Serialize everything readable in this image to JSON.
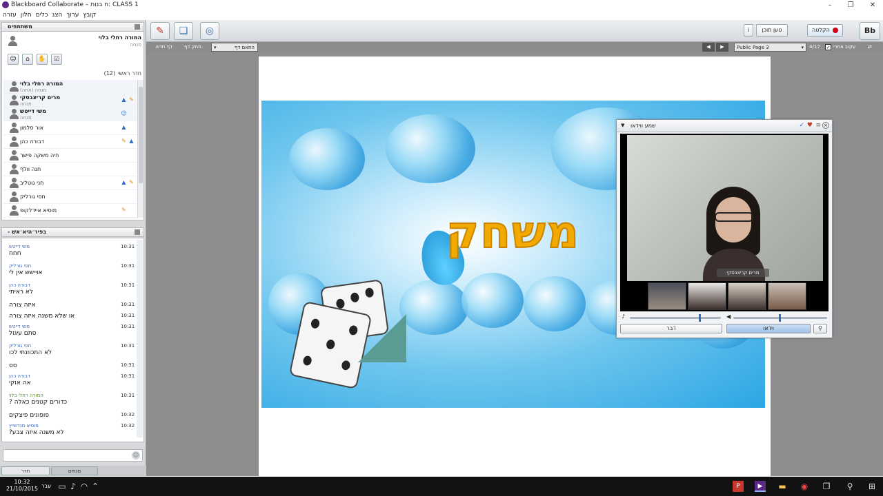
{
  "window": {
    "title": "Blackboard Collaborate – ח בנות: CLASS 1",
    "minimize": "–",
    "maximize": "❐",
    "close": "✕"
  },
  "menu": [
    "קובץ",
    "ערוך",
    "הצג",
    "כלים",
    "חלון",
    "עזרה"
  ],
  "participants_panel": {
    "header": "משתתפים",
    "self": {
      "name": "המורה רחלי בלוי",
      "role": "מנחה"
    },
    "room_label": "חדר ראשי",
    "count": "(12)",
    "list": [
      {
        "name": "המורה רחלי בלוי",
        "role": "מנחה (אתה)",
        "bold": true
      },
      {
        "name": "מרים קריצבסקי",
        "role": "מנחה",
        "bold": true
      },
      {
        "name": "משי דייטש",
        "role": "מנחה",
        "bold": true
      },
      {
        "name": "אור סלמון",
        "role": "",
        "bold": false
      },
      {
        "name": "דבורה כהן",
        "role": "",
        "bold": false
      },
      {
        "name": "חיה משקה פישר",
        "role": "",
        "bold": false
      },
      {
        "name": "חנה וולף",
        "role": "",
        "bold": false
      },
      {
        "name": "חני גוטליב",
        "role": "",
        "bold": false
      },
      {
        "name": "חסי גורליק",
        "role": "",
        "bold": false
      },
      {
        "name": "מוסיא איידלקופ",
        "role": "",
        "bold": false
      }
    ]
  },
  "chat_panel": {
    "header": "- בפיר׳היא׳אש",
    "messages": [
      {
        "who": "משי דייטש",
        "time": "10:31",
        "text": "חחח"
      },
      {
        "who": "חסי גורליק",
        "time": "10:31",
        "text": "אויישש אין לי"
      },
      {
        "who": "דבורה כהן",
        "time": "10:31",
        "text": "לא ראיתי"
      },
      {
        "who": "",
        "time": "10:31",
        "text": "איזה צורה"
      },
      {
        "who": "",
        "time": "10:31",
        "text": "או שלא משנה איזה צורה"
      },
      {
        "who": "משי דייטש",
        "time": "10:31",
        "text": "סתם עיגול"
      },
      {
        "who": "חסי גורליק",
        "time": "10:31",
        "text": "לא התכוונתי לכו"
      },
      {
        "who": "",
        "time": "10:31",
        "text": "סס"
      },
      {
        "who": "דבורה כהן",
        "time": "10:31",
        "text": "אה אוקי"
      },
      {
        "who": "המורה רחלי בלוי",
        "time": "10:31",
        "text": "כדורים קטנים כאלה ?"
      },
      {
        "who": "",
        "time": "10:32",
        "text": "פופונים פיצקים"
      },
      {
        "who": "מוסיא מנדשייץ",
        "time": "10:32",
        "text": "לא משנה איזה צבע?"
      }
    ],
    "input_placeholder": ""
  },
  "left_tabs": {
    "room": "חדר",
    "moderators": "מנחים"
  },
  "top_toolbar": {
    "load_content": "טען תוכן",
    "record": "הקלטה",
    "logo": "Bb"
  },
  "page_bar": {
    "new_page": "דף חדש",
    "delete_page": "מחק דף",
    "fit_page": "התאם דף",
    "follow_label": "עקוב אחרי",
    "page_count": "4/17",
    "page_select": "Public Page 3"
  },
  "slide": {
    "title": "משחק"
  },
  "video_window": {
    "title": "שמע ווידאו",
    "presenter_name": "מרים קריצבסקי",
    "talk_button": "דבר",
    "video_button": "וידאו"
  },
  "taskbar": {
    "time": "10:32",
    "date": "21/10/2015",
    "lang": "עבר"
  },
  "colors": {
    "accent": "#2e6fbf",
    "slide_title": "#f2a900",
    "record_red": "#d0021b"
  }
}
